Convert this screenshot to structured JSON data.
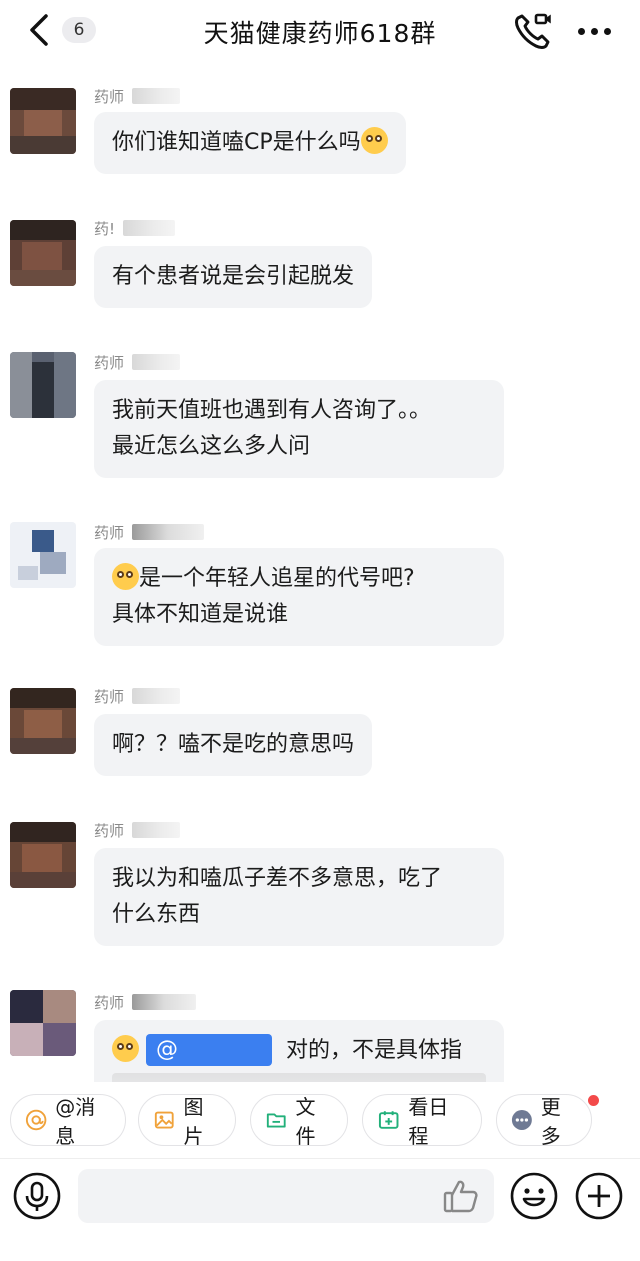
{
  "header": {
    "back_badge": "6",
    "title": "天猫健康药师618群",
    "icons": [
      "back-icon",
      "voice-call-icon",
      "more-icon"
    ]
  },
  "messages": [
    {
      "sender": "药师",
      "lines": [
        "你们谁知道嗑CP是什么吗"
      ],
      "emoji_suffix": "flushed-face-emoji"
    },
    {
      "sender": "药!",
      "lines": [
        "有个患者说是会引起脱发"
      ]
    },
    {
      "sender": "药师",
      "lines": [
        "我前天值班也遇到有人咨询了。。",
        "最近怎么这么多人问"
      ]
    },
    {
      "sender": "药师",
      "lines": [
        "是一个年轻人追星的代号吧?",
        "具体不知道是说谁"
      ],
      "emoji_prefix": "thinking-face-emoji"
    },
    {
      "sender": "药师",
      "lines": [
        "啊？？嗑不是吃的意思吗"
      ]
    },
    {
      "sender": "药师",
      "lines": [
        "我以为和嗑瓜子差不多意思，吃了",
        "什么东西"
      ]
    },
    {
      "sender": "药师",
      "mention": "@",
      "lines": [
        "对的，不是具体指"
      ],
      "emoji_prefix": "laughing-emoji"
    }
  ],
  "quick_actions": [
    {
      "label": "@消息",
      "icon": "at-icon"
    },
    {
      "label": "图片",
      "icon": "image-icon"
    },
    {
      "label": "文件",
      "icon": "folder-icon"
    },
    {
      "label": "看日程",
      "icon": "calendar-icon"
    },
    {
      "label": "更多",
      "icon": "more-dots-icon"
    }
  ],
  "input": {
    "placeholder": "",
    "icons": [
      "microphone-icon",
      "thumbs-up-icon",
      "smiley-icon",
      "plus-icon"
    ]
  },
  "colors": {
    "bubble": "#f2f3f5",
    "mention": "#3b7ff0",
    "notification_dot": "#f34a4a"
  }
}
